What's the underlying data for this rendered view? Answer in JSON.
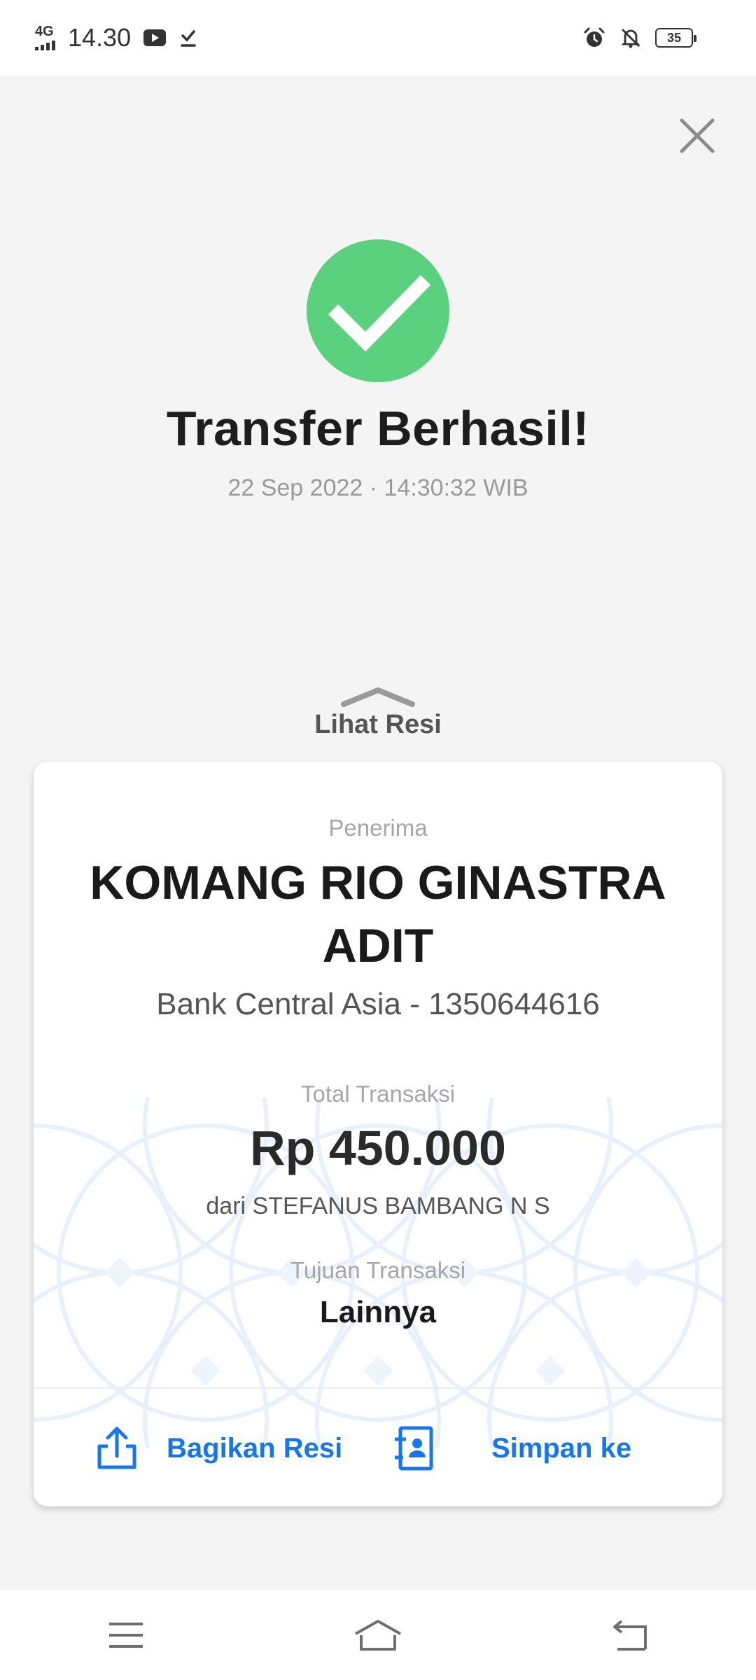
{
  "status_bar": {
    "network": "4G",
    "time": "14.30",
    "battery": "35"
  },
  "icons": {
    "close": "close-icon",
    "success": "checkmark-icon",
    "share": "share-upload-icon",
    "save": "contact-card-add-icon"
  },
  "success": {
    "title": "Transfer Berhasil!",
    "datetime": "22 Sep 2022 · 14:30:32 WIB"
  },
  "receipt_toggle": {
    "label": "Lihat Resi"
  },
  "receipt": {
    "recipient_label": "Penerima",
    "recipient_name": "KOMANG RIO GINASTRA ADIT",
    "bank_account": "Bank Central Asia - 1350644616",
    "total_label": "Total Transaksi",
    "amount": "Rp 450.000",
    "sender": "dari STEFANUS BAMBANG N S",
    "purpose_label": "Tujuan Transaksi",
    "purpose": "Lainnya"
  },
  "actions": {
    "share_label": "Bagikan Resi",
    "save_label": "Simpan ke"
  },
  "colors": {
    "success_green": "#5bd17f",
    "accent_blue": "#1877e8",
    "background": "#f4f4f4"
  }
}
